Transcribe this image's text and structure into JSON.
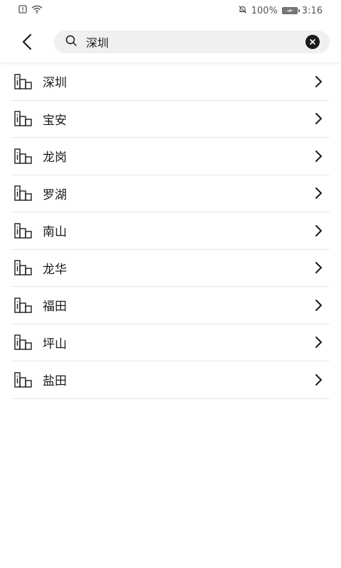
{
  "status_bar": {
    "battery_percent": "100%",
    "time": "3:16"
  },
  "search": {
    "value": "深圳",
    "placeholder": ""
  },
  "results": [
    {
      "label": "深圳"
    },
    {
      "label": "宝安"
    },
    {
      "label": "龙岗"
    },
    {
      "label": "罗湖"
    },
    {
      "label": "南山"
    },
    {
      "label": "龙华"
    },
    {
      "label": "福田"
    },
    {
      "label": "坪山"
    },
    {
      "label": "盐田"
    }
  ],
  "icons": {
    "back": "back-arrow-icon",
    "search": "search-icon",
    "clear": "clear-icon",
    "result_item": "building-icon",
    "row_chevron": "chevron-right-icon"
  }
}
